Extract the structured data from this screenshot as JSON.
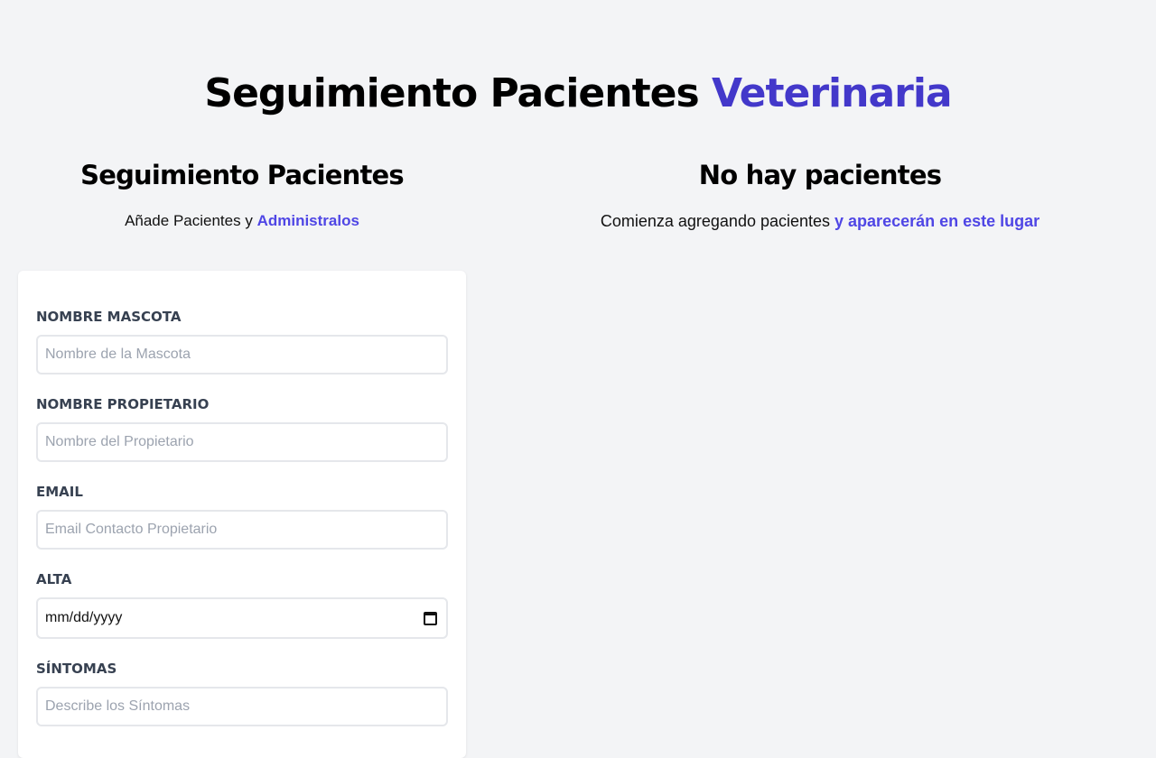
{
  "header": {
    "title_main": "Seguimiento Pacientes",
    "title_accent": "Veterinaria"
  },
  "form_section": {
    "title": "Seguimiento Pacientes",
    "subtitle_plain": "Añade Pacientes y",
    "subtitle_accent": "Administralos"
  },
  "list_section": {
    "title": "No hay pacientes",
    "subtitle_plain": "Comienza agregando pacientes",
    "subtitle_accent": "y aparecerán en este lugar"
  },
  "form": {
    "fields": [
      {
        "label": "NOMBRE MASCOTA",
        "placeholder": "Nombre de la Mascota",
        "value": ""
      },
      {
        "label": "NOMBRE PROPIETARIO",
        "placeholder": "Nombre del Propietario",
        "value": ""
      },
      {
        "label": "EMAIL",
        "placeholder": "Email Contacto Propietario",
        "value": ""
      },
      {
        "label": "ALTA",
        "display_value": "mm/dd/yyyy",
        "icon": "calendar-icon"
      },
      {
        "label": "SÍNTOMAS",
        "placeholder": "Describe los Síntomas",
        "value": ""
      }
    ]
  },
  "colors": {
    "accent": "#4338ca",
    "accent_light": "#4f46e5",
    "background": "#f3f4f6",
    "card": "#ffffff",
    "label": "#374151",
    "placeholder": "#9ca3af"
  }
}
